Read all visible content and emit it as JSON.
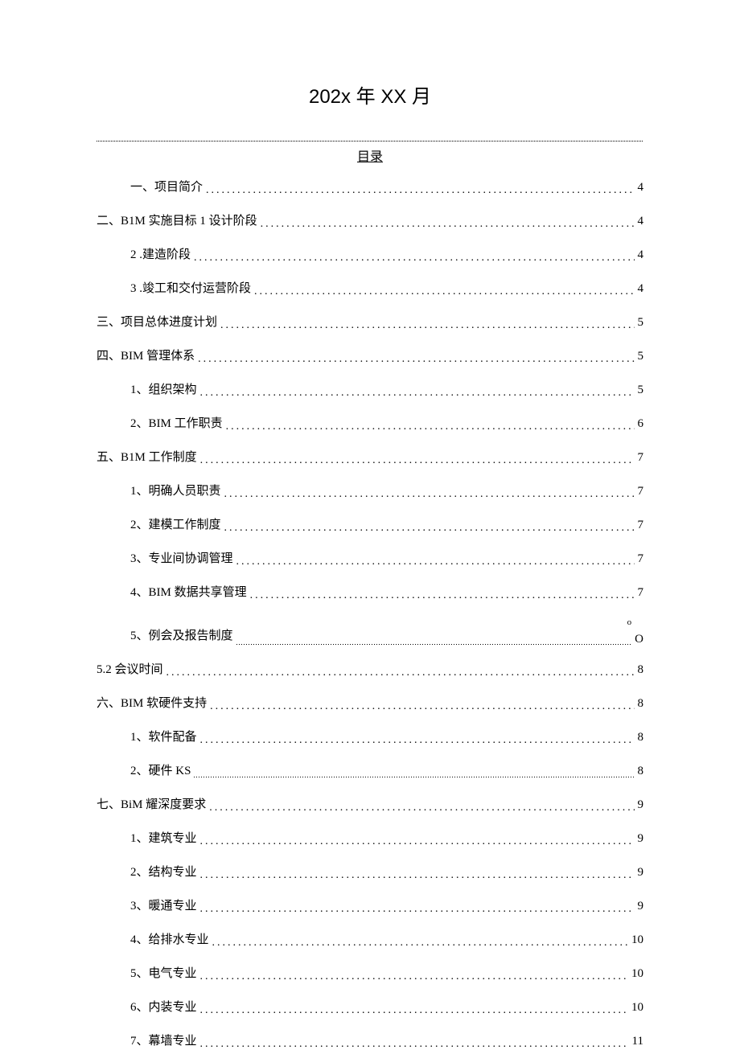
{
  "title": "202x 年 XX 月",
  "toc_title": "目录",
  "toc": [
    {
      "level": 1,
      "label": "一、项目简介",
      "page": "4",
      "style": "dots"
    },
    {
      "level": 0,
      "label": "二、B1M 实施目标 1 设计阶段",
      "page": "4",
      "style": "dots"
    },
    {
      "level": 1,
      "label": "2  .建造阶段",
      "page": "4",
      "style": "dots"
    },
    {
      "level": 1,
      "label": "3  .竣工和交付运营阶段",
      "page": "4",
      "style": "dots"
    },
    {
      "level": 0,
      "label": "三、项目总体进度计划",
      "page": "5",
      "style": "dots"
    },
    {
      "level": 0,
      "label": "四、BIM 管理体系",
      "page": "5",
      "style": "dots"
    },
    {
      "level": 1,
      "label": "1、组织架构",
      "page": "5",
      "style": "dots"
    },
    {
      "level": 1,
      "label": "2、BIM 工作职责",
      "page": "6",
      "style": "dots"
    },
    {
      "level": 0,
      "label": "五、B1M 工作制度",
      "page": "7",
      "style": "dots"
    },
    {
      "level": 1,
      "label": "1、明确人员职责",
      "page": "7",
      "style": "dots"
    },
    {
      "level": 1,
      "label": "2、建模工作制度",
      "page": "7",
      "style": "dots"
    },
    {
      "level": 1,
      "label": "3、专业间协调管理",
      "page": "7",
      "style": "dots"
    },
    {
      "level": 1,
      "label": "4、BIM 数据共享管理",
      "page": "7",
      "style": "dots"
    },
    {
      "level": 1,
      "label": "5、例会及报告制度",
      "page": "O",
      "style": "special5",
      "accent": "o"
    },
    {
      "level": 0,
      "label": "5.2 会议时间",
      "page": "8",
      "style": "dots"
    },
    {
      "level": 0,
      "label": "六、BIM 软硬件支持",
      "page": "8",
      "style": "dots"
    },
    {
      "level": 1,
      "label": "1、软件配备",
      "page": "8",
      "style": "dots"
    },
    {
      "level": 1,
      "label": "2、硬件 KS",
      "page": "8",
      "style": "underline"
    },
    {
      "level": 0,
      "label": "七、BiM 耀深度要求",
      "page": "9",
      "style": "dots"
    },
    {
      "level": 1,
      "label": "1、建筑专业",
      "page": "9",
      "style": "dots"
    },
    {
      "level": 1,
      "label": "2、结构专业",
      "page": "9",
      "style": "dots"
    },
    {
      "level": 1,
      "label": "3、暖通专业",
      "page": "9",
      "style": "dots"
    },
    {
      "level": 1,
      "label": "4、给排水专业",
      "page": "10",
      "style": "dots"
    },
    {
      "level": 1,
      "label": "5、电气专业",
      "page": "10",
      "style": "dots"
    },
    {
      "level": 1,
      "label": "6、内装专业",
      "page": "10",
      "style": "dots"
    },
    {
      "level": 1,
      "label": "7、幕墙专业",
      "page": "11",
      "style": "dots"
    }
  ]
}
